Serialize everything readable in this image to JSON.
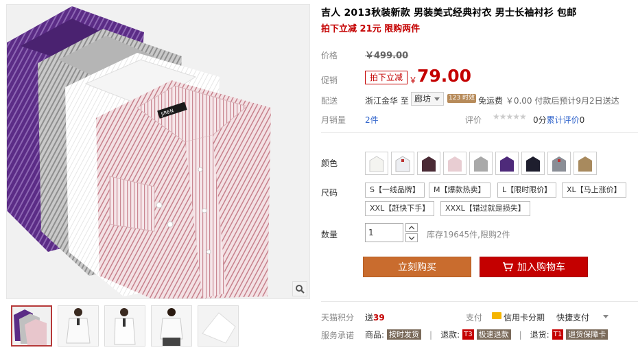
{
  "product": {
    "title": "吉人 2013秋装新款 男装美式经典衬衣 男士长袖衬衫 包邮",
    "subtitle": "拍下立减 21元 限购两件",
    "brand_tag": "JIREN"
  },
  "price": {
    "label": "价格",
    "original": "￥499.00"
  },
  "promo": {
    "label": "促销",
    "tag": "拍下立减",
    "currency": "￥",
    "price": "79.00"
  },
  "shipping": {
    "label": "配送",
    "from": "浙江金华 至",
    "destination": "廊坊",
    "badge": "123 时效",
    "free_label": "免运费",
    "fee": "￥0.00",
    "eta": "付款后预计9月2日送达"
  },
  "sales": {
    "label": "月销量",
    "value": "2件",
    "rating_label": "评价",
    "stars": "★★★★★",
    "score": "0分",
    "review_link": "累计评价",
    "review_count": "0"
  },
  "color": {
    "label": "颜色",
    "swatches": [
      "white",
      "white-stripe",
      "burgundy",
      "pink",
      "gray",
      "purple",
      "navy",
      "gray-stripe",
      "khaki"
    ]
  },
  "size": {
    "label": "尺码",
    "options": [
      "S【一线品牌】",
      "M【爆款热卖】",
      "L【限时限价】",
      "XL【马上涨价】",
      "XXL【赶快下手】",
      "XXXL【错过就是损失】"
    ]
  },
  "quantity": {
    "label": "数量",
    "value": "1",
    "stock": "库存19645件,限购2件"
  },
  "actions": {
    "buy_now": "立刻购买",
    "add_to_cart": "加入购物车"
  },
  "extras": {
    "points_label": "天猫积分",
    "points_prefix": "送",
    "points": "39",
    "pay_label": "支付",
    "card_pay": "信用卡分期",
    "quick_pay": "快捷支付",
    "service_label": "服务承诺",
    "goods_label": "商品:",
    "goods_tag": "按时发货",
    "refund_label": "退款:",
    "refund_code": "T3",
    "refund_tag": "极速退款",
    "return_label": "退货:",
    "return_code": "T1",
    "return_tag": "退货保障卡"
  },
  "colors_meta": {
    "accent": "#c40000",
    "buy_button": "#c96c2e"
  }
}
